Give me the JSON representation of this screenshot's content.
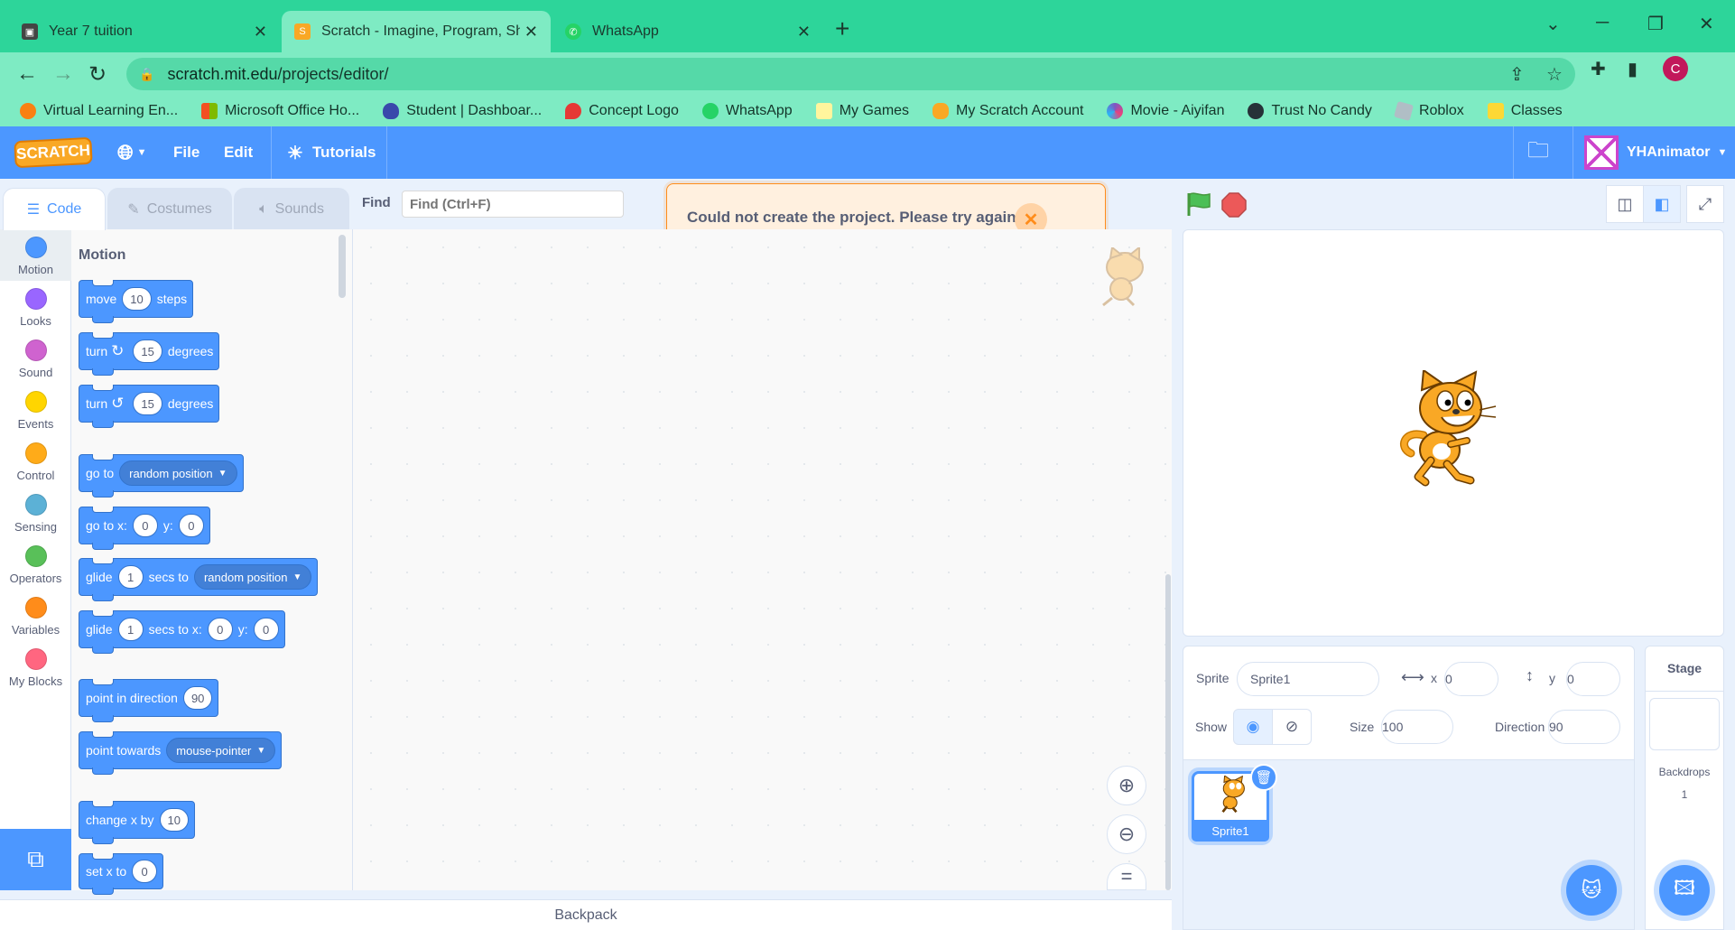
{
  "browser": {
    "tabs": [
      {
        "title": "Year 7 tuition",
        "icon": "classroom-icon",
        "color": "#444444"
      },
      {
        "title": "Scratch - Imagine, Program, Share",
        "icon": "scratch-icon",
        "color": "#f9a825"
      },
      {
        "title": "WhatsApp",
        "icon": "whatsapp-icon",
        "color": "#25d366"
      }
    ],
    "url_host": "scratch.mit.edu",
    "url_path": "/projects/editor/",
    "profile_initial": "C",
    "bookmarks": [
      {
        "label": "Virtual Learning En...",
        "icon": "moodle-icon",
        "color": "#f98012"
      },
      {
        "label": "Microsoft Office Ho...",
        "icon": "microsoft-icon",
        "color": "#f25022"
      },
      {
        "label": "Student | Dashboar...",
        "icon": "shield-icon",
        "color": "#3949ab"
      },
      {
        "label": "Concept Logo",
        "icon": "flame-icon",
        "color": "#e53935"
      },
      {
        "label": "WhatsApp",
        "icon": "whatsapp-icon",
        "color": "#25d366"
      },
      {
        "label": "My Games",
        "icon": "folder-icon",
        "color": "#fff59d"
      },
      {
        "label": "My Scratch Account",
        "icon": "scratch-icon",
        "color": "#f9a825"
      },
      {
        "label": "Movie - Aiyifan",
        "icon": "pinwheel-icon",
        "color": "#7e57c2"
      },
      {
        "label": "Trust No Candy",
        "icon": "globe-icon",
        "color": "#263238"
      },
      {
        "label": "Roblox",
        "icon": "roblox-icon",
        "color": "#b0bec5"
      },
      {
        "label": "Classes",
        "icon": "classroom-icon",
        "color": "#fdd835"
      }
    ]
  },
  "menubar": {
    "logo": "SCRATCH",
    "file": "File",
    "edit": "Edit",
    "tutorials": "Tutorials",
    "username": "YHAnimator"
  },
  "editor_tabs": {
    "code": "Code",
    "costumes": "Costumes",
    "sounds": "Sounds"
  },
  "find": {
    "label": "Find",
    "placeholder": "Find (Ctrl+F)"
  },
  "alert": {
    "message": "Could not create the project. Please try again!"
  },
  "categories": [
    {
      "label": "Motion",
      "color": "#4c97ff"
    },
    {
      "label": "Looks",
      "color": "#9966ff"
    },
    {
      "label": "Sound",
      "color": "#cf63cf"
    },
    {
      "label": "Events",
      "color": "#ffd500"
    },
    {
      "label": "Control",
      "color": "#ffab19"
    },
    {
      "label": "Sensing",
      "color": "#5cb1d6"
    },
    {
      "label": "Operators",
      "color": "#59c059"
    },
    {
      "label": "Variables",
      "color": "#ff8c1a"
    },
    {
      "label": "My Blocks",
      "color": "#ff6680"
    }
  ],
  "flyout": {
    "heading": "Motion",
    "move": {
      "a": "move",
      "v": "10",
      "b": "steps"
    },
    "turn_right": {
      "a": "turn",
      "v": "15",
      "b": "degrees"
    },
    "turn_left": {
      "a": "turn",
      "v": "15",
      "b": "degrees"
    },
    "goto": {
      "a": "go to",
      "dd": "random position"
    },
    "goto_xy": {
      "a": "go to x:",
      "x": "0",
      "b": "y:",
      "y": "0"
    },
    "glide_to": {
      "a": "glide",
      "v": "1",
      "b": "secs to",
      "dd": "random position"
    },
    "glide_xy": {
      "a": "glide",
      "v": "1",
      "b": "secs to x:",
      "x": "0",
      "c": "y:",
      "y": "0"
    },
    "point_dir": {
      "a": "point in direction",
      "v": "90"
    },
    "point_towards": {
      "a": "point towards",
      "dd": "mouse-pointer"
    },
    "change_x": {
      "a": "change x by",
      "v": "10"
    },
    "set_x": {
      "a": "set x to",
      "v": "0"
    }
  },
  "backpack": "Backpack",
  "sprite_info": {
    "sprite_label": "Sprite",
    "sprite_name": "Sprite1",
    "x_label": "x",
    "x": "0",
    "y_label": "y",
    "y": "0",
    "show_label": "Show",
    "size_label": "Size",
    "size": "100",
    "direction_label": "Direction",
    "direction": "90"
  },
  "sprites": [
    {
      "name": "Sprite1"
    }
  ],
  "stage_pane": {
    "title": "Stage",
    "backdrops_label": "Backdrops",
    "backdrops_count": "1"
  }
}
